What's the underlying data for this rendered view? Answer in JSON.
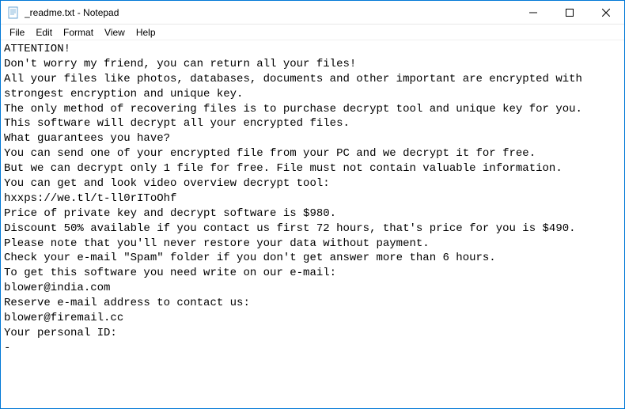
{
  "window": {
    "title": "_readme.txt - Notepad"
  },
  "menubar": {
    "items": [
      "File",
      "Edit",
      "Format",
      "View",
      "Help"
    ]
  },
  "content": {
    "text": "ATTENTION!\nDon't worry my friend, you can return all your files!\nAll your files like photos, databases, documents and other important are encrypted with strongest encryption and unique key.\nThe only method of recovering files is to purchase decrypt tool and unique key for you.\nThis software will decrypt all your encrypted files.\nWhat guarantees you have?\nYou can send one of your encrypted file from your PC and we decrypt it for free.\nBut we can decrypt only 1 file for free. File must not contain valuable information.\nYou can get and look video overview decrypt tool:\nhxxps://we.tl/t-ll0rIToOhf\nPrice of private key and decrypt software is $980.\nDiscount 50% available if you contact us first 72 hours, that's price for you is $490.\nPlease note that you'll never restore your data without payment.\nCheck your e-mail \"Spam\" folder if you don't get answer more than 6 hours.\nTo get this software you need write on our e-mail:\nblower@india.com\nReserve e-mail address to contact us:\nblower@firemail.cc\nYour personal ID:\n-"
  }
}
